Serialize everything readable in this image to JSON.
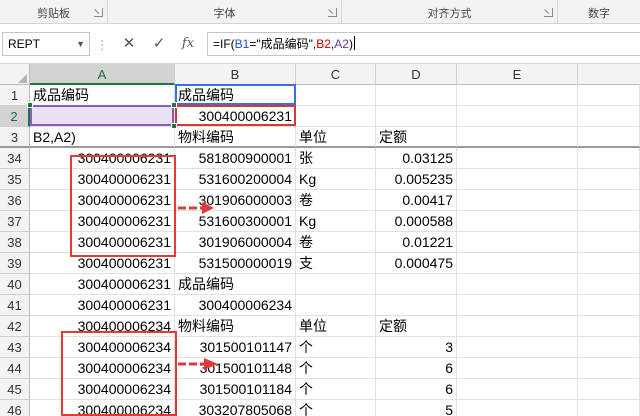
{
  "ribbon": {
    "groups": [
      {
        "label": "剪贴板"
      },
      {
        "label": "字体"
      },
      {
        "label": "对齐方式"
      },
      {
        "label": "数字"
      }
    ]
  },
  "formula_bar": {
    "name_box": "REPT",
    "formula_parts": [
      "=IF(",
      "B1",
      "=\"成品编码\",",
      "B2",
      ",",
      "A2",
      ")"
    ],
    "buttons": {
      "cancel": "✕",
      "enter": "✓",
      "fx": "fx"
    }
  },
  "columns": [
    "A",
    "B",
    "C",
    "D",
    "E"
  ],
  "active_column": "A",
  "rows": [
    {
      "num": "1",
      "a": "成品编码",
      "b": "成品编码",
      "c": "",
      "d": ""
    },
    {
      "num": "2",
      "a": "",
      "b": "300400006231",
      "c": "",
      "d": ""
    },
    {
      "num": "3",
      "a": "B2,A2)",
      "b": "物料编码",
      "c": "单位",
      "d": "定额"
    },
    {
      "num": "34",
      "a": "300400006231",
      "b": "581800900001",
      "c": "张",
      "d": "0.03125"
    },
    {
      "num": "35",
      "a": "300400006231",
      "b": "531600200004",
      "c": "Kg",
      "d": "0.005235"
    },
    {
      "num": "36",
      "a": "300400006231",
      "b": "301906000003",
      "c": "卷",
      "d": "0.00417"
    },
    {
      "num": "37",
      "a": "300400006231",
      "b": "531600300001",
      "c": "Kg",
      "d": "0.000588"
    },
    {
      "num": "38",
      "a": "300400006231",
      "b": "301906000004",
      "c": "卷",
      "d": "0.01221"
    },
    {
      "num": "39",
      "a": "300400006231",
      "b": "531500000019",
      "c": "支",
      "d": "0.000475"
    },
    {
      "num": "40",
      "a": "300400006231",
      "b": "成品编码",
      "c": "",
      "d": ""
    },
    {
      "num": "41",
      "a": "300400006231",
      "b": "300400006234",
      "c": "",
      "d": ""
    },
    {
      "num": "42",
      "a": "300400006234",
      "b": "物料编码",
      "c": "单位",
      "d": "定额"
    },
    {
      "num": "43",
      "a": "300400006234",
      "b": "301500101147",
      "c": "个",
      "d": "3"
    },
    {
      "num": "44",
      "a": "300400006234",
      "b": "301500101148",
      "c": "个",
      "d": "6"
    },
    {
      "num": "45",
      "a": "300400006234",
      "b": "301500101184",
      "c": "个",
      "d": "6"
    },
    {
      "num": "46",
      "a": "300400006234",
      "b": "303207805068",
      "c": "个",
      "d": "5"
    }
  ],
  "active_row": "2",
  "colors": {
    "annotation_red": "#e23a3a",
    "ref_b1": "#3b6fd8",
    "ref_a2": "#8a5bc0",
    "ref_b2": "#d23a3a",
    "excel_green": "#217346"
  }
}
